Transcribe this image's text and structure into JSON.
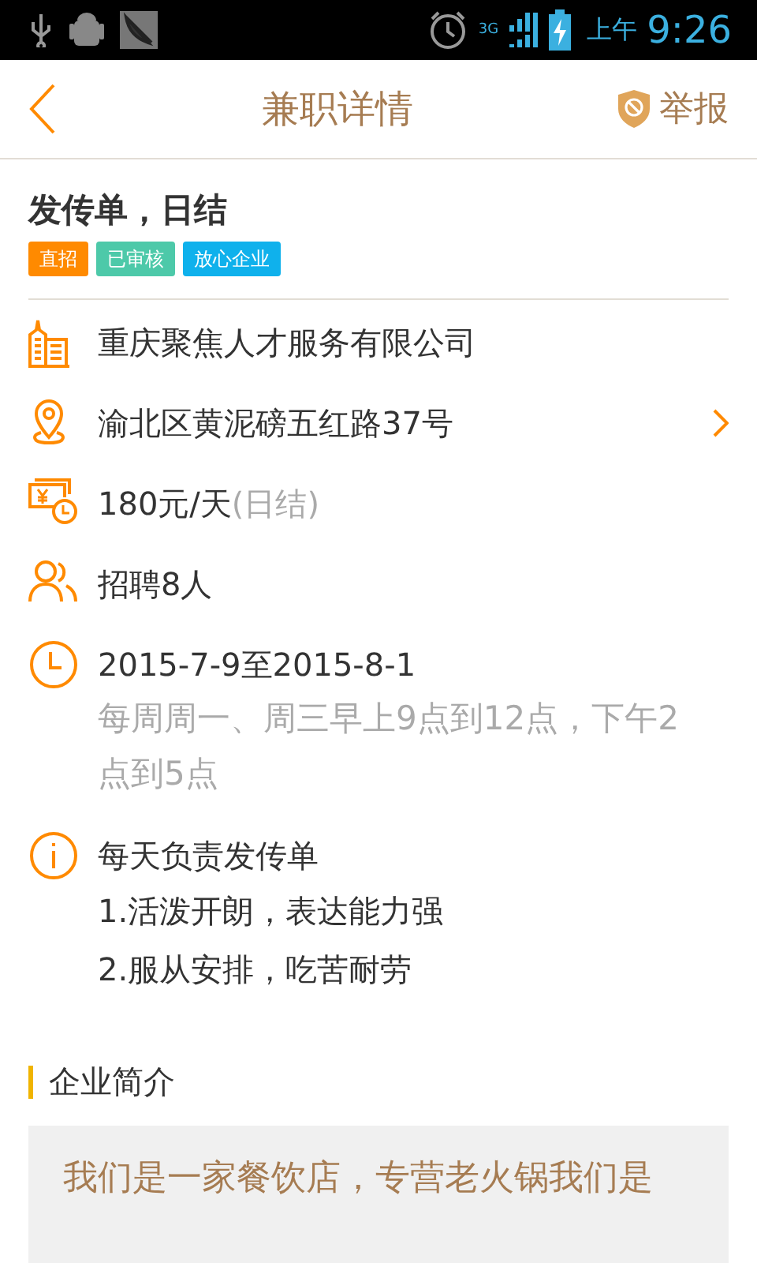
{
  "status_bar": {
    "network": "3G",
    "ampm": "上午",
    "time": "9:26"
  },
  "header": {
    "title": "兼职详情",
    "report": "举报"
  },
  "job": {
    "title": "发传单，日结",
    "tags": [
      {
        "label": "直招",
        "color": "#ff8a00"
      },
      {
        "label": "已审核",
        "color": "#4dc9a9"
      },
      {
        "label": "放心企业",
        "color": "#0fb1ec"
      }
    ]
  },
  "details": [
    {
      "kind": "company",
      "text": "重庆聚焦人才服务有限公司"
    },
    {
      "kind": "address",
      "text": "渝北区黄泥磅五红路37号",
      "chevron": true
    },
    {
      "kind": "salary",
      "text": "180元/天",
      "note": "(日结)"
    },
    {
      "kind": "headcount",
      "text": "招聘8人"
    },
    {
      "kind": "period",
      "text": "2015-7-9至2015-8-1",
      "note": "每周周一、周三早上9点到12点，下午2点到5点"
    },
    {
      "kind": "description",
      "text": "每天负责发传单",
      "lines": [
        "1.活泼开朗，表达能力强",
        "2.服从安排，吃苦耐劳"
      ]
    }
  ],
  "company_intro": {
    "title": "企业简介",
    "body": "我们是一家餐饮店，专营老火锅我们是"
  }
}
